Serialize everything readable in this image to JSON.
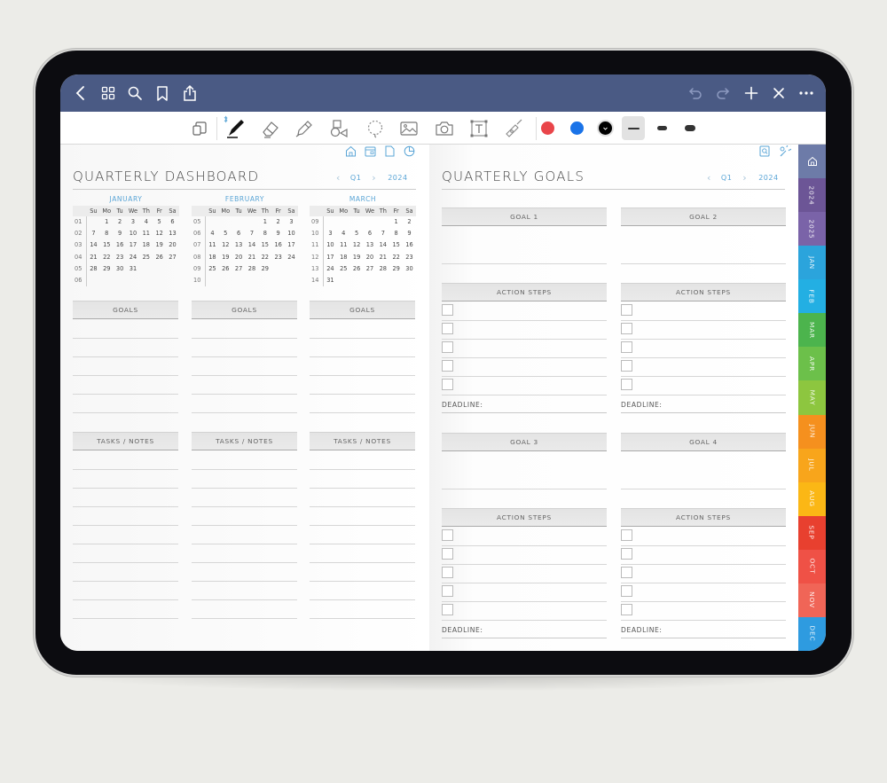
{
  "topbar": {
    "left_icons": [
      "back-icon",
      "grid-icon",
      "search-icon",
      "bookmark-icon",
      "share-icon"
    ],
    "right_icons": [
      "undo-icon",
      "redo-icon",
      "add-page-icon",
      "close-icon",
      "more-icon"
    ]
  },
  "toolbar": {
    "tools": [
      "page-layout-icon",
      "pen-icon",
      "eraser-icon",
      "highlighter-icon",
      "shapes-icon",
      "lasso-icon",
      "image-icon",
      "camera-icon",
      "text-box-icon",
      "laser-pointer-icon"
    ],
    "colors": [
      "#e9454a",
      "#1a73e8",
      "#000000"
    ],
    "selected_color": "#000000",
    "stroke_sizes": [
      "thin",
      "medium",
      "thick"
    ],
    "selected_stroke": "thin"
  },
  "left_page": {
    "nav_icons": [
      "home-icon",
      "calendar-icon",
      "page-icon",
      "pie-chart-icon"
    ],
    "title": "QUARTERLY DASHBOARD",
    "quarter": "Q1",
    "year": "2024",
    "weekdays": [
      "Su",
      "Mo",
      "Tu",
      "We",
      "Th",
      "Fr",
      "Sa"
    ],
    "months": [
      {
        "name": "JANUARY",
        "weeks": [
          {
            "wk": "01",
            "days": [
              "",
              "1",
              "2",
              "3",
              "4",
              "5",
              "6"
            ]
          },
          {
            "wk": "02",
            "days": [
              "7",
              "8",
              "9",
              "10",
              "11",
              "12",
              "13"
            ]
          },
          {
            "wk": "03",
            "days": [
              "14",
              "15",
              "16",
              "17",
              "18",
              "19",
              "20"
            ]
          },
          {
            "wk": "04",
            "days": [
              "21",
              "22",
              "23",
              "24",
              "25",
              "26",
              "27"
            ]
          },
          {
            "wk": "05",
            "days": [
              "28",
              "29",
              "30",
              "31",
              "",
              "",
              ""
            ]
          },
          {
            "wk": "06",
            "days": [
              "",
              "",
              "",
              "",
              "",
              "",
              ""
            ]
          }
        ]
      },
      {
        "name": "FEBRUARY",
        "weeks": [
          {
            "wk": "05",
            "days": [
              "",
              "",
              "",
              "",
              "1",
              "2",
              "3"
            ]
          },
          {
            "wk": "06",
            "days": [
              "4",
              "5",
              "6",
              "7",
              "8",
              "9",
              "10"
            ]
          },
          {
            "wk": "07",
            "days": [
              "11",
              "12",
              "13",
              "14",
              "15",
              "16",
              "17"
            ]
          },
          {
            "wk": "08",
            "days": [
              "18",
              "19",
              "20",
              "21",
              "22",
              "23",
              "24"
            ]
          },
          {
            "wk": "09",
            "days": [
              "25",
              "26",
              "27",
              "28",
              "29",
              "",
              ""
            ]
          },
          {
            "wk": "10",
            "days": [
              "",
              "",
              "",
              "",
              "",
              "",
              ""
            ]
          }
        ]
      },
      {
        "name": "MARCH",
        "weeks": [
          {
            "wk": "09",
            "days": [
              "",
              "",
              "",
              "",
              "",
              "1",
              "2"
            ]
          },
          {
            "wk": "10",
            "days": [
              "3",
              "4",
              "5",
              "6",
              "7",
              "8",
              "9"
            ]
          },
          {
            "wk": "11",
            "days": [
              "10",
              "11",
              "12",
              "13",
              "14",
              "15",
              "16"
            ]
          },
          {
            "wk": "12",
            "days": [
              "17",
              "18",
              "19",
              "20",
              "21",
              "22",
              "23"
            ]
          },
          {
            "wk": "13",
            "days": [
              "24",
              "25",
              "26",
              "27",
              "28",
              "29",
              "30"
            ]
          },
          {
            "wk": "14",
            "days": [
              "31",
              "",
              "",
              "",
              "",
              "",
              ""
            ]
          }
        ]
      }
    ],
    "goals_label": "GOALS",
    "tasks_label": "TASKS / NOTES"
  },
  "right_page": {
    "nav_icons": [
      "search-page-icon",
      "settings-icon"
    ],
    "title": "QUARTERLY GOALS",
    "quarter": "Q1",
    "year": "2024",
    "goals": [
      {
        "label": "GOAL 1",
        "action_steps_label": "ACTION STEPS",
        "deadline_label": "DEADLINE:"
      },
      {
        "label": "GOAL 2",
        "action_steps_label": "ACTION STEPS",
        "deadline_label": "DEADLINE:"
      },
      {
        "label": "GOAL 3",
        "action_steps_label": "ACTION STEPS",
        "deadline_label": "DEADLINE:"
      },
      {
        "label": "GOAL 4",
        "action_steps_label": "ACTION STEPS",
        "deadline_label": "DEADLINE:"
      }
    ]
  },
  "side_tabs": [
    {
      "label": "home",
      "icon": "home-icon",
      "color": "#6d7ba8"
    },
    {
      "label": "2024",
      "color": "#6c5596"
    },
    {
      "label": "2025",
      "color": "#7a63a8"
    },
    {
      "label": "JAN",
      "color": "#2ba4dc"
    },
    {
      "label": "FEB",
      "color": "#23afe3"
    },
    {
      "label": "MAR",
      "color": "#4cb44d"
    },
    {
      "label": "APR",
      "color": "#6cc04a"
    },
    {
      "label": "MAY",
      "color": "#8dc63f"
    },
    {
      "label": "JUN",
      "color": "#f5901e"
    },
    {
      "label": "JUL",
      "color": "#f8a51b"
    },
    {
      "label": "AUG",
      "color": "#fbb715"
    },
    {
      "label": "SEP",
      "color": "#e8402f"
    },
    {
      "label": "OCT",
      "color": "#ef5146"
    },
    {
      "label": "NOV",
      "color": "#f06557"
    },
    {
      "label": "DEC",
      "color": "#2e9be0"
    }
  ]
}
